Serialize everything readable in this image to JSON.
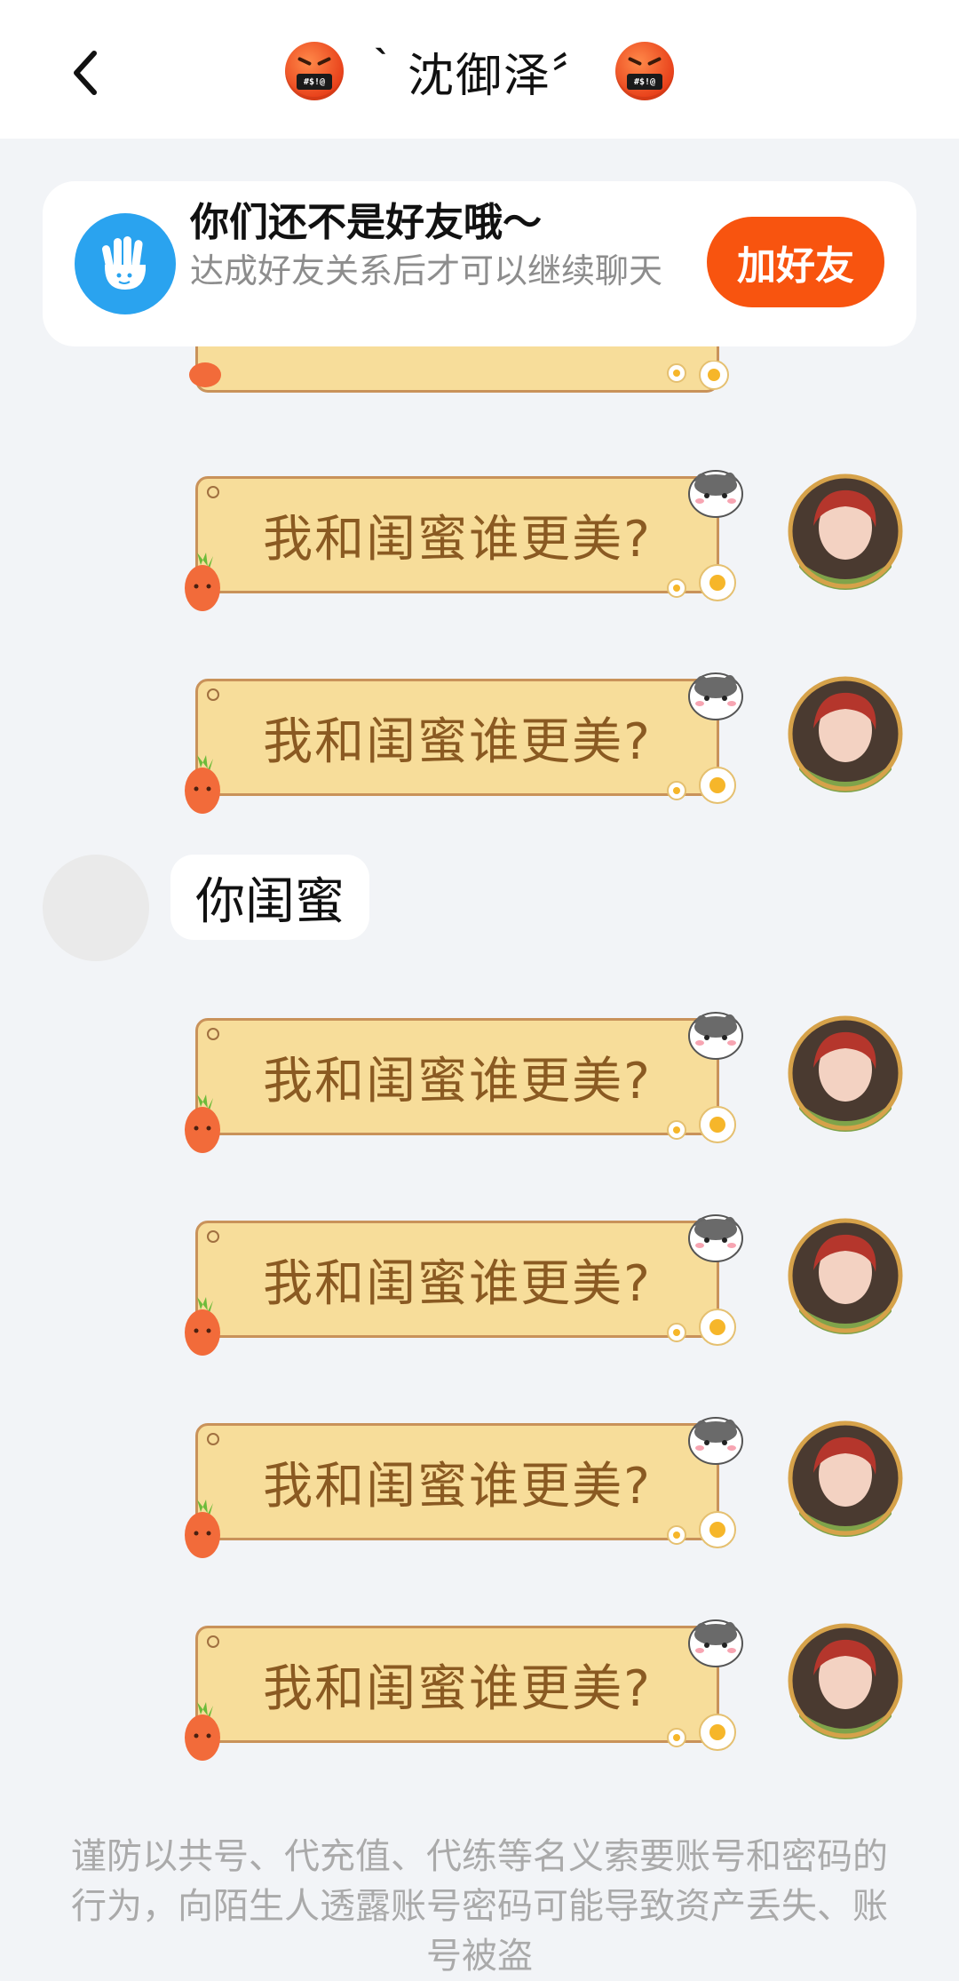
{
  "header": {
    "title": "｀沈御泽〞",
    "emoji_text": "#$!@",
    "back_icon": "chevron-left-icon"
  },
  "friend_notice": {
    "title": "你们还不是好友哦～",
    "subtitle": "达成好友关系后才可以继续聊天",
    "button": "加好友",
    "icon": "hand-wave-icon",
    "accent": "#f8540f",
    "icon_color": "#2aa3ef"
  },
  "messages": {
    "card_text": "我和闺蜜谁更美?",
    "card_color": "#f7dd9a",
    "card_text_color": "#8a5a22",
    "other_reply": "你闺蜜"
  },
  "footer": {
    "warning": "谨防以共号、代充值、代练等名义索要账号和密码的行为，向陌生人透露账号密码可能导致资产丢失、账号被盗"
  }
}
